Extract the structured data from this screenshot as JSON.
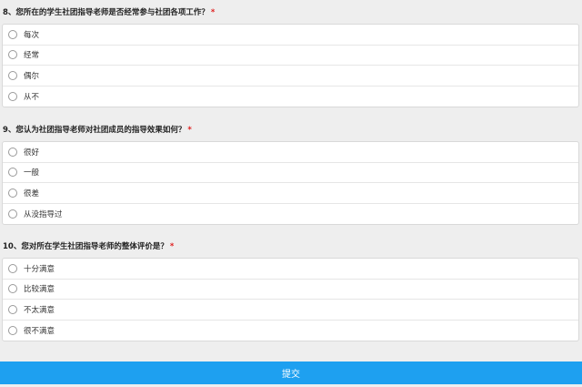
{
  "questions": [
    {
      "title": "8、您所在的学生社团指导老师是否经常参与社团各项工作？",
      "required_mark": "*",
      "options": [
        "每次",
        "经常",
        "偶尔",
        "从不"
      ]
    },
    {
      "title": "9、您认为社团指导老师对社团成员的指导效果如何？",
      "required_mark": "*",
      "options": [
        "很好",
        "一般",
        "很差",
        "从没指导过"
      ]
    },
    {
      "title": "10、您对所在学生社团指导老师的整体评价是？",
      "required_mark": "*",
      "options": [
        "十分满意",
        "比较满意",
        "不太满意",
        "很不满意"
      ]
    }
  ],
  "submit_label": "提交",
  "colors": {
    "background": "#eeeeee",
    "required": "#e02020",
    "submit_bg": "#1ea0f0"
  },
  "icons": {
    "option_marker": "radio-button-unchecked-icon"
  }
}
